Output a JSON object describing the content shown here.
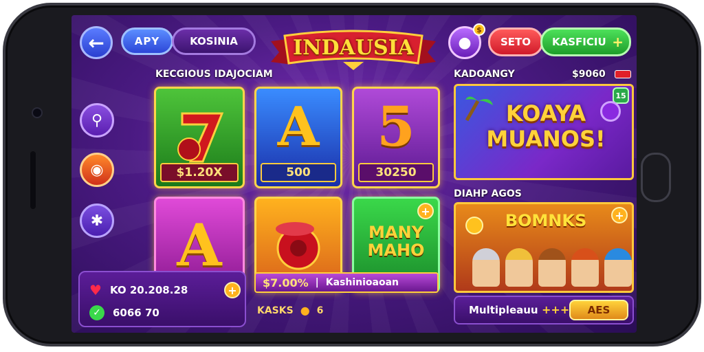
{
  "topbar": {
    "tab_primary": "APY",
    "tab_secondary": "KOSINIA",
    "banner_title": "INDAUSIA",
    "store_label": "SETO",
    "cash_label": "KASFICIU",
    "cash_plus": "+"
  },
  "left": {
    "section_title": "KECGIOUS IDAJOCIAM"
  },
  "tiles": [
    {
      "price": "$1.20X"
    },
    {
      "glyph": "A",
      "price": "500"
    },
    {
      "glyph": "5",
      "price": "30250"
    },
    {
      "glyph": "A"
    },
    {},
    {
      "text_line1": "MANY",
      "text_line2": "MAHO"
    }
  ],
  "tile_overlay": {
    "price": "$7.00%",
    "separator": "|",
    "label": "Kashinioaoan"
  },
  "stats": {
    "row1_value": "KO 20.208.28",
    "row2_value": "6066 70",
    "plus": "+"
  },
  "below_tiles": {
    "label": "KASKS",
    "count": "6"
  },
  "right": {
    "section1_title": "KADOANGY",
    "balance": "$9060",
    "promo1_title_line1": "KOAYA",
    "promo1_title_line2": "MUANOS!",
    "promo1_badge": "15",
    "section2_title": "DIAHP AGOS",
    "promo2_title": "BOMNKS",
    "promo2_plus": "+",
    "multiplier_label": "Multipleauu",
    "multiplier_stars": "+++",
    "action_button": "AES"
  }
}
